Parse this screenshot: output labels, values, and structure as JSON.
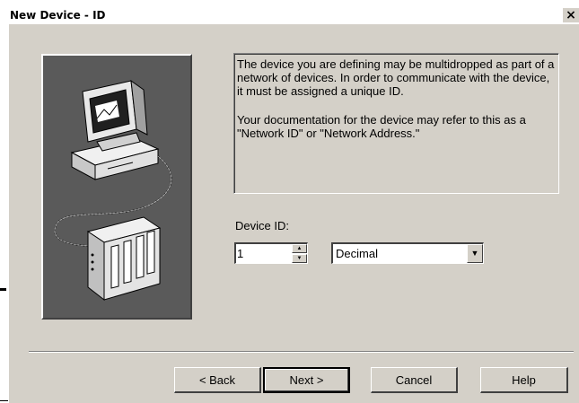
{
  "window": {
    "title": "New Device - ID",
    "close_glyph": "×"
  },
  "info": {
    "paragraph1": "The device you are defining may be multidropped as part of a network of devices.  In order to communicate with the device, it must be assigned a unique ID.",
    "paragraph2": "Your documentation for the device may refer to this as a \"Network ID\" or \"Network Address.\""
  },
  "device_id": {
    "label": "Device ID:",
    "value": "1"
  },
  "format": {
    "selected": "Decimal"
  },
  "buttons": {
    "back": "< Back",
    "next": "Next >",
    "cancel": "Cancel",
    "help": "Help"
  },
  "icons": {
    "illustration": "computer-network-device-icon",
    "spin_up": "up-arrow-icon",
    "spin_down": "down-arrow-icon",
    "dropdown": "chevron-down-icon"
  }
}
